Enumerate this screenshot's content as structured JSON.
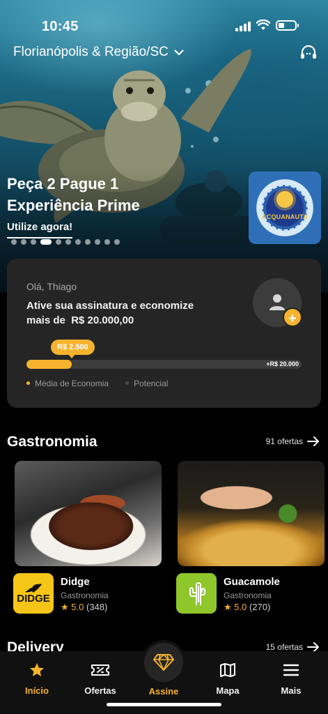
{
  "status_bar": {
    "time": "10:45"
  },
  "header": {
    "location": "Florianópolis & Região/SC"
  },
  "promo": {
    "title_line1": "Peça 2 Pague 1",
    "title_line2": "Experiência Prime",
    "cta": "Utilize agora!",
    "dot_count": 11,
    "active_dot": 3,
    "partner_logo_text": "ACQUANAUTA"
  },
  "savings": {
    "greeting": "Olá, Thiago",
    "message_line1": "Ative sua assinatura e economize",
    "message_line2": "mais de  R$ 20.000,00",
    "current_label": "R$ 2.500",
    "max_label": "+R$ 20.000",
    "progress": 0.165,
    "legend_avg": "Média de Economia",
    "legend_potential": "Potencial",
    "accent_color": "#f6b32d"
  },
  "gastronomia": {
    "title": "Gastronomia",
    "count_link": "91 ofertas",
    "offers": [
      {
        "logo_text": "DIDGE",
        "name": "Didge",
        "category": "Gastronomia",
        "star": "★",
        "rating": "5.0",
        "reviews": "(348)"
      },
      {
        "logo_text": "",
        "name": "Guacamole",
        "category": "Gastronomia",
        "star": "★",
        "rating": "5.0",
        "reviews": "(270)"
      }
    ]
  },
  "delivery": {
    "title": "Delivery",
    "count_link": "15 ofertas"
  },
  "tabbar": {
    "tabs": [
      {
        "label": "Início",
        "icon": "star-icon"
      },
      {
        "label": "Ofertas",
        "icon": "ticket-icon"
      },
      {
        "label": "Assine",
        "icon": "diamond-icon"
      },
      {
        "label": "Mapa",
        "icon": "map-icon"
      },
      {
        "label": "Mais",
        "icon": "menu-icon"
      }
    ]
  }
}
